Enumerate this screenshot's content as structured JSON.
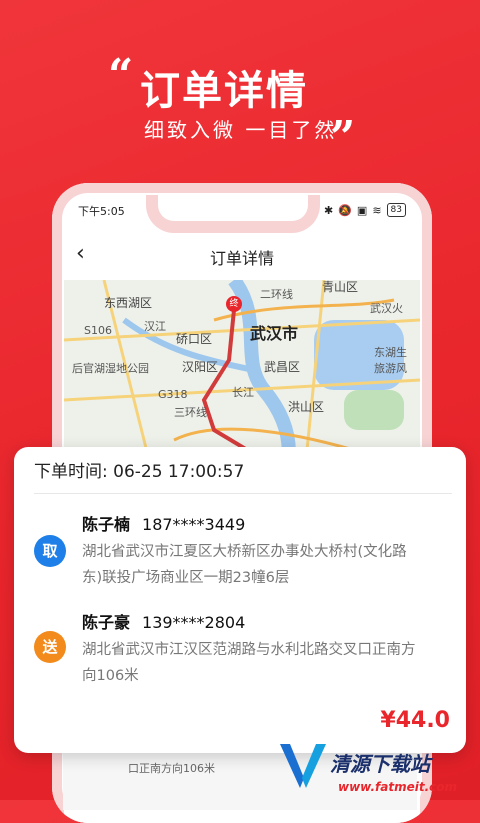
{
  "promo": {
    "quote_open": "“",
    "quote_close": "”",
    "title": "订单详情",
    "subtitle": "细致入微 一目了然"
  },
  "status_bar": {
    "time": "下午5:05",
    "icons": [
      "bluetooth-icon",
      "mute-icon",
      "sim-icon",
      "wifi-icon"
    ],
    "battery": "83"
  },
  "app_bar": {
    "back": "‹",
    "title": "订单详情"
  },
  "map": {
    "labels": {
      "city": "武汉市",
      "east_west_lake": "东西湖区",
      "hanyang": "汉阳区",
      "qiaokou": "硚口区",
      "wuchang": "武昌区",
      "hongshan": "洪山区",
      "qingshan": "青山区",
      "wuhan_station": "武汉火",
      "donghu": "东湖生",
      "donghu2": "旅游风",
      "hougong": "后官湖湿地公园",
      "ring2": "二环线",
      "ring3": "三环线",
      "hanjiang": "汉江",
      "changjiang": "长江",
      "s106": "S106",
      "g318": "G318"
    },
    "marker": "终"
  },
  "order": {
    "time_label": "下单时间: 06-25 17:00:57",
    "pickup": {
      "badge": "取",
      "name": "陈子楠",
      "phone": "187****3449",
      "address": "湖北省武汉市江夏区大桥新区办事处大桥村(文化路东)联投广场商业区一期23幢6层"
    },
    "delivery": {
      "badge": "送",
      "name": "陈子豪",
      "phone": "139****2804",
      "address": "湖北省武汉市江汉区范湖路与水利北路交叉口正南方向106米"
    },
    "price": "¥44.0"
  },
  "background_peek": {
    "text": "口正南方向106米"
  },
  "watermark": {
    "title": "清源下载站",
    "url": "www.fatmeit.com"
  },
  "colors": {
    "brand_red": "#e8262c",
    "pickup_blue": "#1e7fe8",
    "delivery_orange": "#f28a1c"
  }
}
